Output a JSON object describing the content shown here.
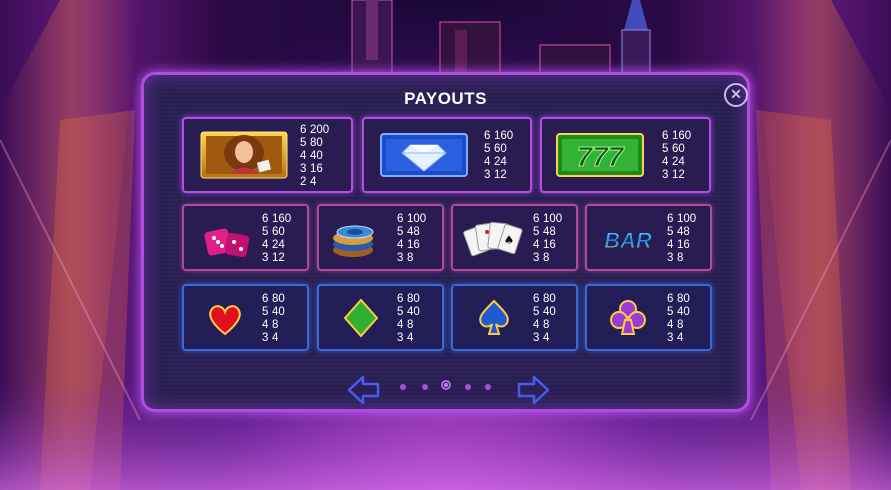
{
  "dialog": {
    "title": "PAYOUTS",
    "close_label": "✕"
  },
  "pagination": {
    "pages": 5,
    "current_page": 3
  },
  "colors": {
    "frame": "#b24be0",
    "pink_row": "#b04a9a",
    "blue_row": "#3a6ad8",
    "panel": "#2d2158"
  },
  "rows": [
    {
      "tier": "premium",
      "symbols": [
        {
          "icon": "lady-symbol-icon",
          "pays": [
            [
              "6",
              "200"
            ],
            [
              "5",
              "80"
            ],
            [
              "4",
              "40"
            ],
            [
              "3",
              "16"
            ],
            [
              "2",
              "4"
            ]
          ]
        },
        {
          "icon": "diamond-symbol-icon",
          "pays": [
            [
              "6",
              "160"
            ],
            [
              "5",
              "60"
            ],
            [
              "4",
              "24"
            ],
            [
              "3",
              "12"
            ]
          ]
        },
        {
          "icon": "seven-seven-seven-symbol-icon",
          "pays": [
            [
              "6",
              "160"
            ],
            [
              "5",
              "60"
            ],
            [
              "4",
              "24"
            ],
            [
              "3",
              "12"
            ]
          ]
        }
      ]
    },
    {
      "tier": "middle",
      "symbols": [
        {
          "icon": "dice-symbol-icon",
          "pays": [
            [
              "6",
              "160"
            ],
            [
              "5",
              "60"
            ],
            [
              "4",
              "24"
            ],
            [
              "3",
              "12"
            ]
          ]
        },
        {
          "icon": "chips-symbol-icon",
          "pays": [
            [
              "6",
              "100"
            ],
            [
              "5",
              "48"
            ],
            [
              "4",
              "16"
            ],
            [
              "3",
              "8"
            ]
          ]
        },
        {
          "icon": "cards-symbol-icon",
          "pays": [
            [
              "6",
              "100"
            ],
            [
              "5",
              "48"
            ],
            [
              "4",
              "16"
            ],
            [
              "3",
              "8"
            ]
          ]
        },
        {
          "icon": "bar-symbol-icon",
          "label": "BAR",
          "pays": [
            [
              "6",
              "100"
            ],
            [
              "5",
              "48"
            ],
            [
              "4",
              "16"
            ],
            [
              "3",
              "8"
            ]
          ]
        }
      ]
    },
    {
      "tier": "low",
      "symbols": [
        {
          "icon": "heart-symbol-icon",
          "pays": [
            [
              "6",
              "80"
            ],
            [
              "5",
              "40"
            ],
            [
              "4",
              "8"
            ],
            [
              "3",
              "4"
            ]
          ]
        },
        {
          "icon": "diamond-suit-symbol-icon",
          "pays": [
            [
              "6",
              "80"
            ],
            [
              "5",
              "40"
            ],
            [
              "4",
              "8"
            ],
            [
              "3",
              "4"
            ]
          ]
        },
        {
          "icon": "spade-symbol-icon",
          "pays": [
            [
              "6",
              "80"
            ],
            [
              "5",
              "40"
            ],
            [
              "4",
              "8"
            ],
            [
              "3",
              "4"
            ]
          ]
        },
        {
          "icon": "club-symbol-icon",
          "pays": [
            [
              "6",
              "80"
            ],
            [
              "5",
              "40"
            ],
            [
              "4",
              "8"
            ],
            [
              "3",
              "4"
            ]
          ]
        }
      ]
    }
  ]
}
